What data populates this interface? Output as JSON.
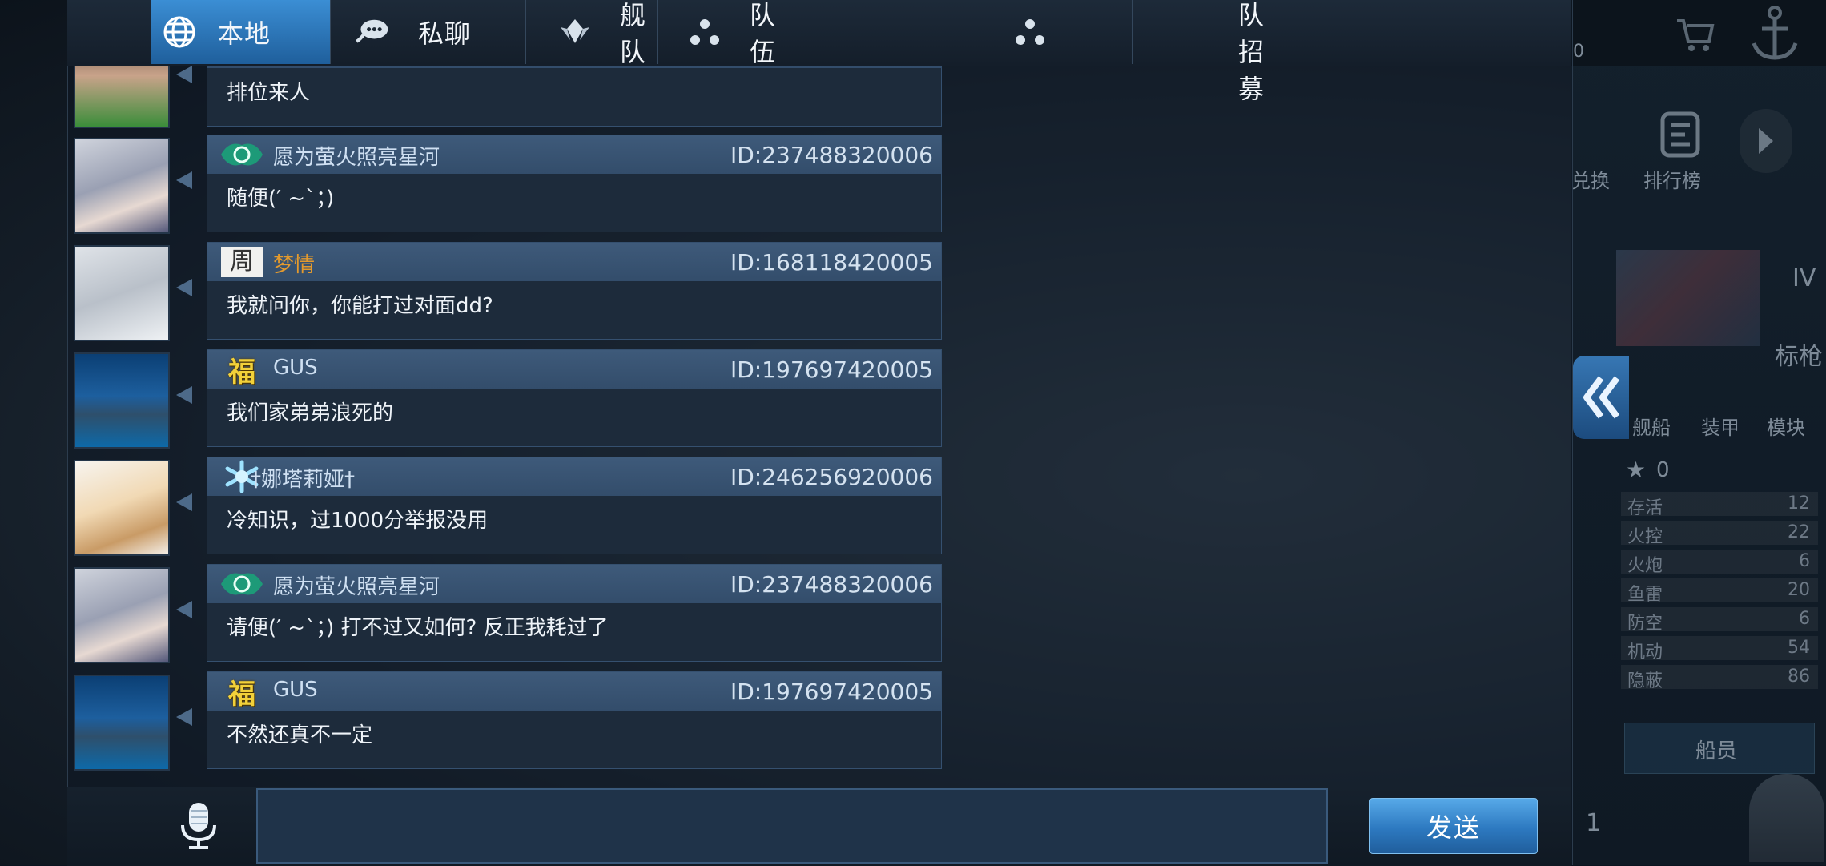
{
  "tabs": [
    {
      "label": "本地",
      "icon": "globe-icon",
      "active": true
    },
    {
      "label": "私聊",
      "icon": "chat-bubble-icon",
      "active": false
    },
    {
      "label": "舰队",
      "icon": "fleet-icon",
      "active": false
    },
    {
      "label": "队伍",
      "icon": "team-dots-icon",
      "active": false
    },
    {
      "label": "舰队招募",
      "icon": "team-dots-icon",
      "active": false
    }
  ],
  "messages": [
    {
      "username": "",
      "uid": "",
      "text": "排位来人",
      "avatar": "avatar-kid",
      "badge": ""
    },
    {
      "username": "愿为萤火照亮星河",
      "uid": "ID:237488320006",
      "text": "随便(′ ~`；)",
      "avatar": "avatar-silver-hair",
      "badge": "emblem-green"
    },
    {
      "username": "梦情",
      "uid": "ID:168118420005",
      "text": "我就问你，你能打过对面dd?",
      "avatar": "avatar-sleeping",
      "badge": "emblem-character",
      "name_color": "orange"
    },
    {
      "username": "GUS",
      "uid": "ID:197697420005",
      "text": "我们家弟弟浪死的",
      "avatar": "avatar-ship",
      "badge": "emblem-fu"
    },
    {
      "username": "†娜塔莉娅†",
      "uid": "ID:246256920006",
      "text": "冷知识，过1000分举报没用",
      "avatar": "avatar-bear-girl",
      "badge": "emblem-snowflake"
    },
    {
      "username": "愿为萤火照亮星河",
      "uid": "ID:237488320006",
      "text": "请便(′ ~`；) 打不过又如何? 反正我耗过了",
      "avatar": "avatar-silver-hair",
      "badge": "emblem-green"
    },
    {
      "username": "GUS",
      "uid": "ID:197697420005",
      "text": "不然还真不一定",
      "avatar": "avatar-ship",
      "badge": "emblem-fu"
    }
  ],
  "badges": {
    "fu": "福",
    "character": "周"
  },
  "input": {
    "value": "",
    "placeholder": ""
  },
  "send_label": "发送",
  "right_panel": {
    "tier": "IV",
    "ship_type": "标枪",
    "tabs": [
      "舰船",
      "装甲",
      "模块"
    ],
    "buttons": [
      "兑换",
      "排行榜"
    ],
    "stars": "0",
    "stats": [
      {
        "label": "存活",
        "value": "12"
      },
      {
        "label": "火控",
        "value": "22"
      },
      {
        "label": "火炮",
        "value": "6"
      },
      {
        "label": "鱼雷",
        "value": "20"
      },
      {
        "label": "防空",
        "value": "6"
      },
      {
        "label": "机动",
        "value": "54"
      },
      {
        "label": "隐蔽",
        "value": "86"
      }
    ],
    "crew_button": "船员",
    "crew_count": "1",
    "top_value": "0"
  }
}
